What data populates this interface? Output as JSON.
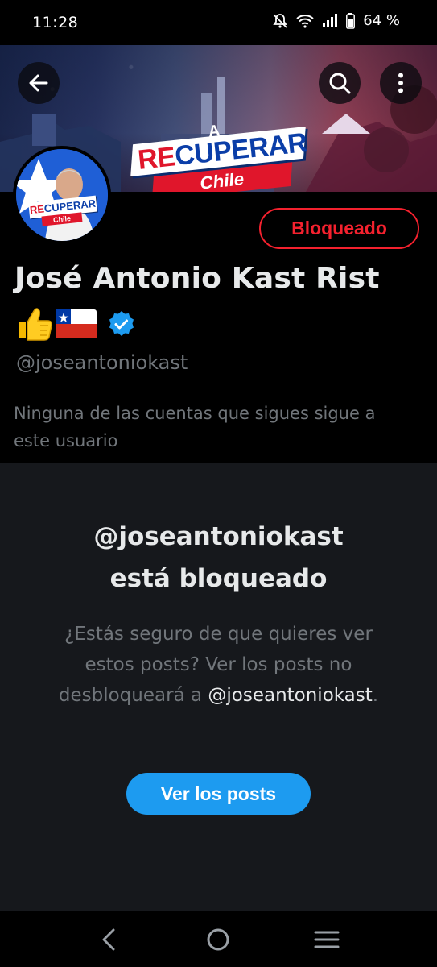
{
  "status_bar": {
    "time": "11:28",
    "battery": "64 %",
    "icons": [
      "notifications-off-icon",
      "wifi-icon",
      "signal-icon",
      "battery-icon"
    ]
  },
  "header": {
    "icons": [
      "back-arrow-icon",
      "search-icon",
      "more-vertical-icon"
    ],
    "banner_logo": {
      "a": "A",
      "re": "RE",
      "cuperar": "CUPERAR",
      "chile": "Chile"
    }
  },
  "avatar_logo": {
    "re": "RE",
    "cuperar": "CUPERAR",
    "chile": "Chile"
  },
  "profile": {
    "blocked_button": "Bloqueado",
    "display_name": "José Antonio Kast Rist",
    "emojis": [
      "👍",
      "🇨🇱"
    ],
    "verified_icon": "verified-badge-icon",
    "handle": "@joseantoniokast",
    "followers_note": "Ninguna de las cuentas que sigues sigue a este usuario"
  },
  "blocked_notice": {
    "title_line1": "@joseantoniokast",
    "title_line2": "está bloqueado",
    "description": "¿Estás seguro de que quieres ver estos posts? Ver los posts no desbloqueará a",
    "description_handle": "@joseantoniokast",
    "description_end": ".",
    "view_posts_button": "Ver los posts"
  },
  "nav_bar": {
    "icons": [
      "nav-back-icon",
      "nav-home-icon",
      "nav-recents-icon"
    ]
  },
  "colors": {
    "accent_blue": "#1d9bf0",
    "blocked_red": "#f4212e",
    "background": "#000000",
    "panel": "#16181c",
    "muted_text": "#71767b"
  }
}
